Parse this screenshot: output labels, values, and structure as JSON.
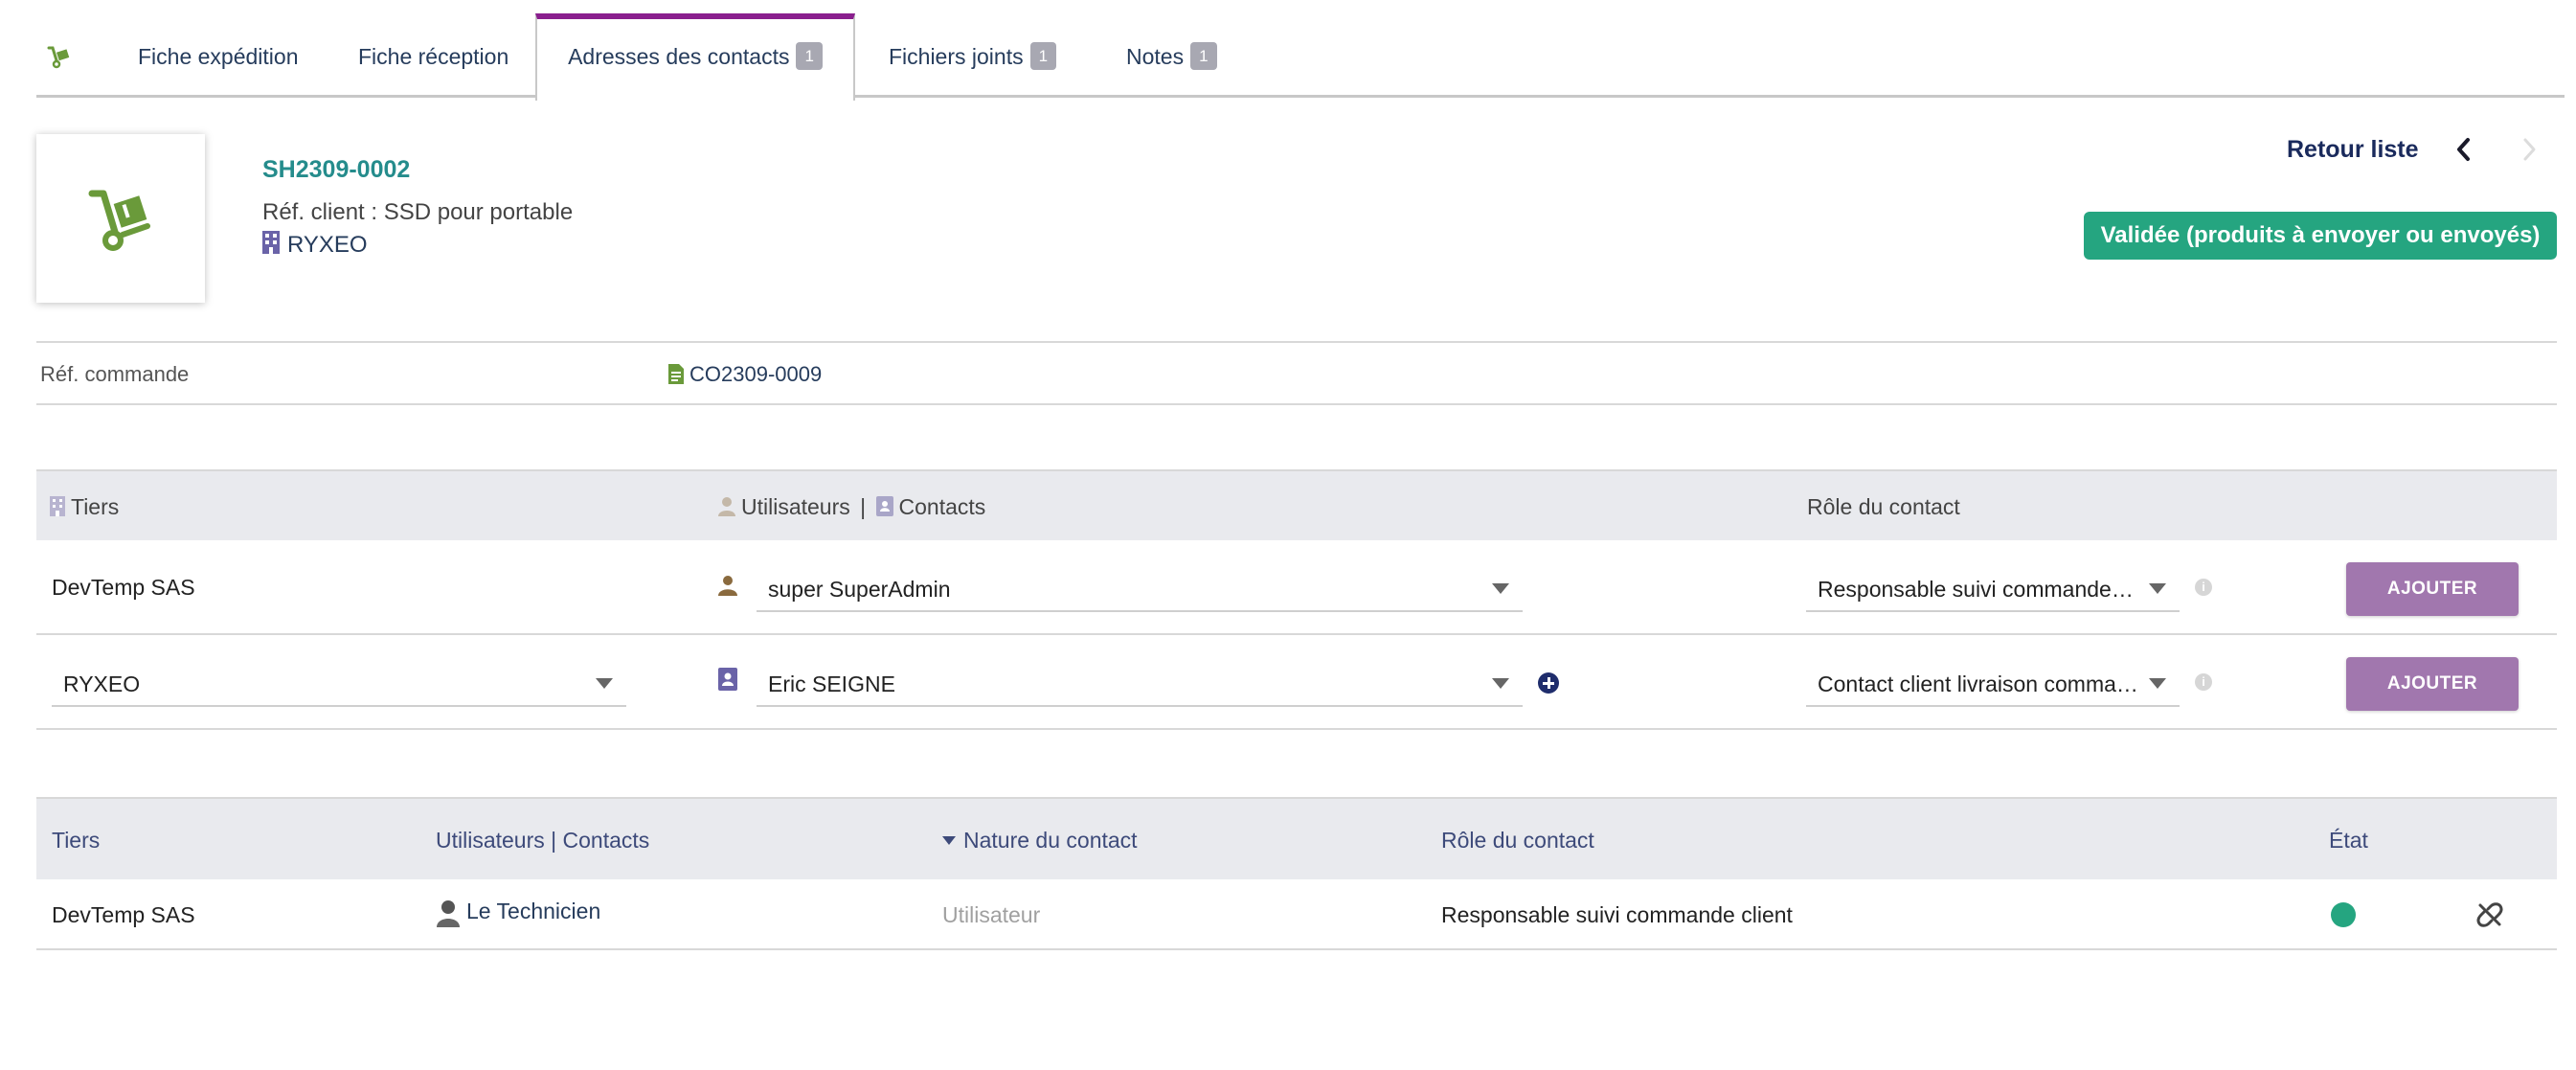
{
  "tabs": [
    {
      "label": "Fiche expédition"
    },
    {
      "label": "Fiche réception"
    },
    {
      "label": "Adresses des contacts",
      "badge": "1",
      "active": true
    },
    {
      "label": "Fichiers joints",
      "badge": "1"
    },
    {
      "label": "Notes",
      "badge": "1"
    }
  ],
  "header": {
    "ref": "SH2309-0002",
    "ref_client": "Réf. client : SSD pour portable",
    "company": "RYXEO",
    "back_label": "Retour liste",
    "status_label": "Validée (produits à envoyer ou envoyés)"
  },
  "ref_commande": {
    "label": "Réf. commande",
    "value": "CO2309-0009"
  },
  "add_table": {
    "headers": {
      "tiers": "Tiers",
      "users": "Utilisateurs",
      "separator": "|",
      "contacts": "Contacts",
      "role": "Rôle du contact"
    },
    "rows": [
      {
        "tiers": "DevTemp SAS",
        "contact": "super SuperAdmin",
        "role": "Responsable suivi commande client",
        "button": "AJOUTER"
      },
      {
        "tiers": "RYXEO",
        "contact": "Eric SEIGNE",
        "role": "Contact client livraison commande",
        "button": "AJOUTER"
      }
    ]
  },
  "list_table": {
    "headers": {
      "tiers": "Tiers",
      "users_contacts": "Utilisateurs | Contacts",
      "nature": "Nature du contact",
      "role": "Rôle du contact",
      "state": "État"
    },
    "rows": [
      {
        "tiers": "DevTemp SAS",
        "contact": "Le Technicien",
        "nature": "Utilisateur",
        "role": "Responsable suivi commande client",
        "state_color": "#25a580"
      }
    ]
  },
  "colors": {
    "accent_tab": "#8a1f8e",
    "status_green": "#25a580",
    "add_button": "#a177ae",
    "link": "#263c5c",
    "ref_teal": "#258c8c"
  }
}
